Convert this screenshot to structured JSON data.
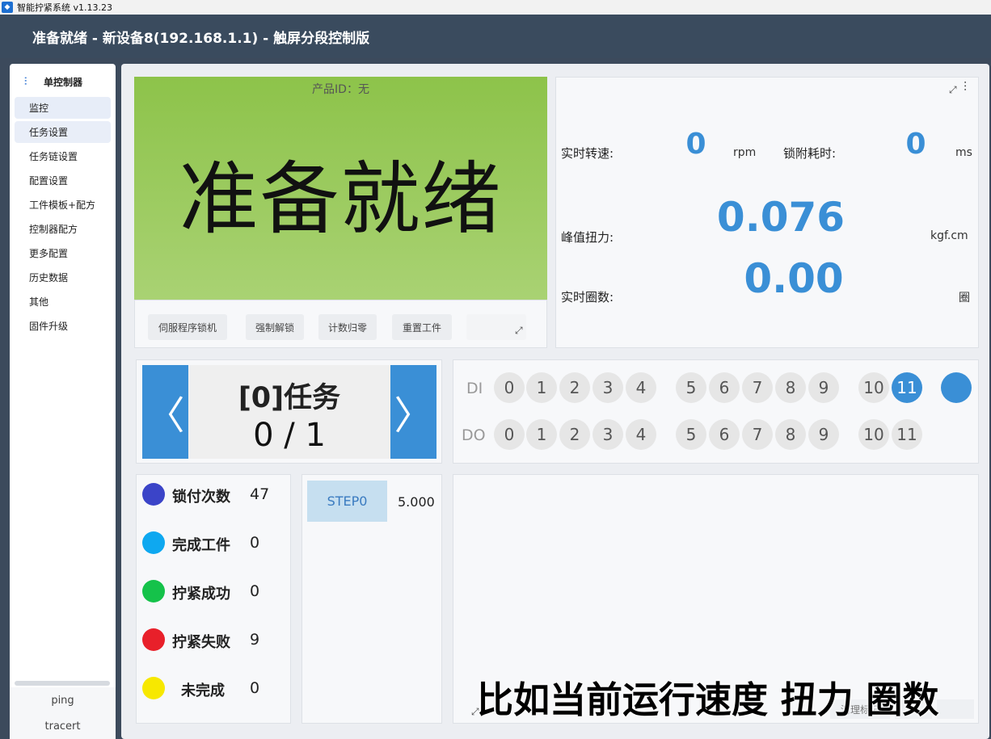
{
  "window": {
    "title": "智能拧紧系统  v1.13.23"
  },
  "header": {
    "title": "准备就绪 - 新设备8(192.168.1.1) - 触屏分段控制版"
  },
  "sidebar": {
    "heading": "单控制器",
    "items": [
      {
        "label": "监控"
      },
      {
        "label": "任务设置"
      },
      {
        "label": "任务链设置"
      },
      {
        "label": "配置设置"
      },
      {
        "label": "工件模板+配方"
      },
      {
        "label": "控制器配方"
      },
      {
        "label": "更多配置"
      },
      {
        "label": "历史数据"
      },
      {
        "label": "其他"
      },
      {
        "label": "固件升级"
      }
    ],
    "bottom": {
      "ping": "ping",
      "tracert": "tracert"
    }
  },
  "status": {
    "product_id": "产品ID：无",
    "text": "准备就绪",
    "bg_color": "#8dc34a"
  },
  "actions": {
    "servo_lock": "伺服程序锁机",
    "force_unlock": "强制解锁",
    "count_reset": "计数归零",
    "reset_workpiece": "重置工件"
  },
  "metrics": {
    "speed_label": "实时转速:",
    "speed_value": "0",
    "speed_unit": "rpm",
    "lock_time_label": "锁附耗时:",
    "lock_time_value": "0",
    "lock_time_unit": "ms",
    "peak_torque_label": "峰值扭力:",
    "peak_torque_value": "0.076",
    "peak_torque_unit": "kgf.cm",
    "turns_label": "实时圈数:",
    "turns_value": "0.00",
    "turns_unit": "圈",
    "value_color": "#3a8fd6"
  },
  "task": {
    "name": "[0]任务",
    "progress": "0 / 1",
    "prev_glyph": "〈",
    "next_glyph": "〉"
  },
  "io": {
    "di_label": "DI",
    "do_label": "DO",
    "di": [
      "0",
      "1",
      "2",
      "3",
      "4",
      "5",
      "6",
      "7",
      "8",
      "9",
      "10",
      "11"
    ],
    "do": [
      "0",
      "1",
      "2",
      "3",
      "4",
      "5",
      "6",
      "7",
      "8",
      "9",
      "10",
      "11"
    ],
    "di_active": [
      "11"
    ]
  },
  "stats": [
    {
      "label": "锁付次数",
      "value": "47",
      "color": "#3b44c8"
    },
    {
      "label": "完成工件",
      "value": "0",
      "color": "#0ea8f0"
    },
    {
      "label": "拧紧成功",
      "value": "0",
      "color": "#15c24a"
    },
    {
      "label": "拧紧失败",
      "value": "9",
      "color": "#e8202a"
    },
    {
      "label": "未完成",
      "value": "0",
      "color": "#f7e800"
    }
  ],
  "steps": [
    {
      "label": "STEP0",
      "value": "5.000"
    }
  ],
  "chart_panel": {
    "clear_label": "清理标记"
  },
  "subtitle": "比如当前运行速度 扭力 圈数"
}
